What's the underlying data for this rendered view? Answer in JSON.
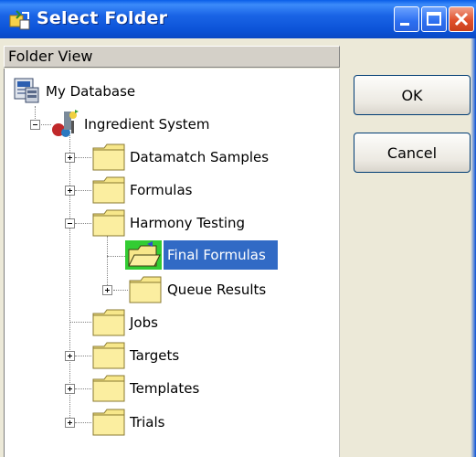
{
  "window": {
    "title": "Select Folder",
    "title_icon": "app-folder-icon",
    "controls": [
      "minimize-icon",
      "maximize-icon",
      "close-icon"
    ]
  },
  "folder_view": {
    "header": "Folder View",
    "root": "My Database",
    "system": "Ingredient System",
    "items": [
      {
        "label": "Datamatch Samples",
        "expander": "plus"
      },
      {
        "label": "Formulas",
        "expander": "plus"
      },
      {
        "label": "Harmony Testing",
        "expander": "minus"
      },
      {
        "label": "Final Formulas",
        "expander": "none",
        "selected": true
      },
      {
        "label": "Queue Results",
        "expander": "plus"
      },
      {
        "label": "Jobs",
        "expander": "none"
      },
      {
        "label": "Targets",
        "expander": "plus"
      },
      {
        "label": "Templates",
        "expander": "plus"
      },
      {
        "label": "Trials",
        "expander": "plus"
      }
    ]
  },
  "buttons": {
    "ok": "OK",
    "cancel": "Cancel"
  },
  "colors": {
    "titlebar": "#0b52d6",
    "selection": "#316ac5",
    "folder": "#f7e78a"
  }
}
